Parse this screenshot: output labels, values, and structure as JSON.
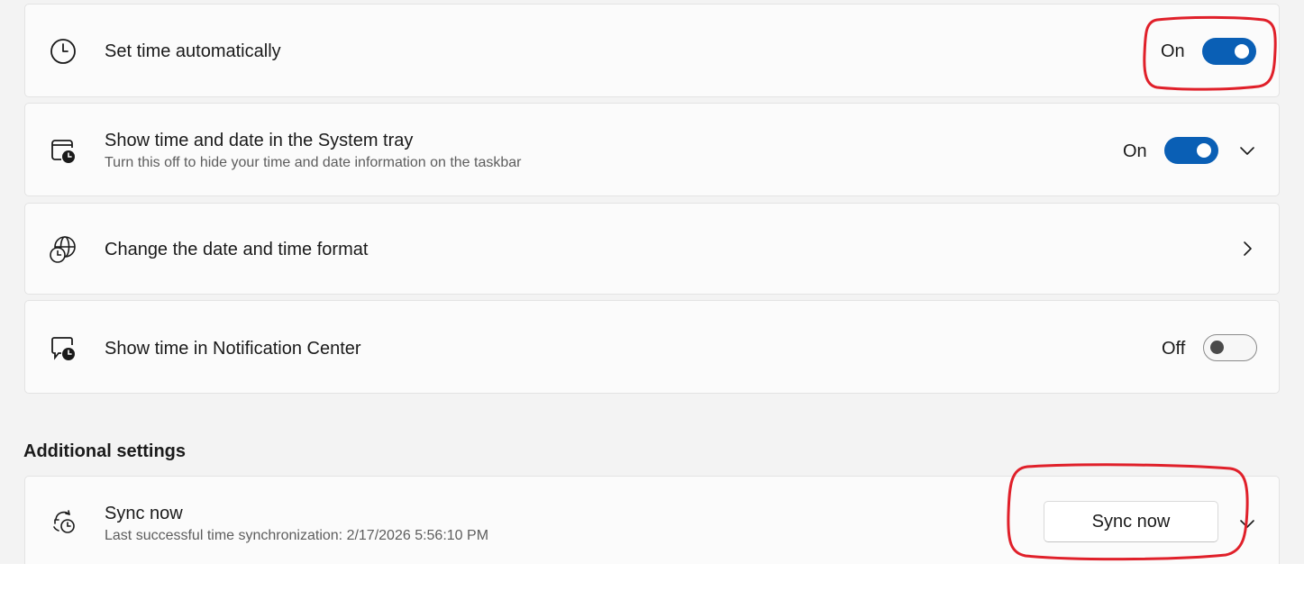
{
  "settings": [
    {
      "title": "Set time automatically",
      "state": "On"
    },
    {
      "title": "Show time and date in the System tray",
      "subtitle": "Turn this off to hide your time and date information on the taskbar",
      "state": "On"
    },
    {
      "title": "Change the date and time format"
    },
    {
      "title": "Show time in Notification Center",
      "state": "Off"
    }
  ],
  "additional": {
    "header": "Additional settings",
    "sync": {
      "title": "Sync now",
      "subtitle": "Last successful time synchronization: 2/17/2026 5:56:10 PM",
      "button_label": "Sync now"
    }
  },
  "colors": {
    "accent": "#0a5fb5",
    "annotation": "#e0202a",
    "background": "#f3f3f3",
    "card": "#fbfbfb"
  },
  "icons": {
    "set_time": "clock-icon",
    "system_tray": "calendar-clock-icon",
    "format": "globe-clock-icon",
    "notification": "chat-clock-icon",
    "sync": "sync-clock-icon",
    "expand": "chevron-down-icon",
    "navigate": "chevron-right-icon"
  }
}
